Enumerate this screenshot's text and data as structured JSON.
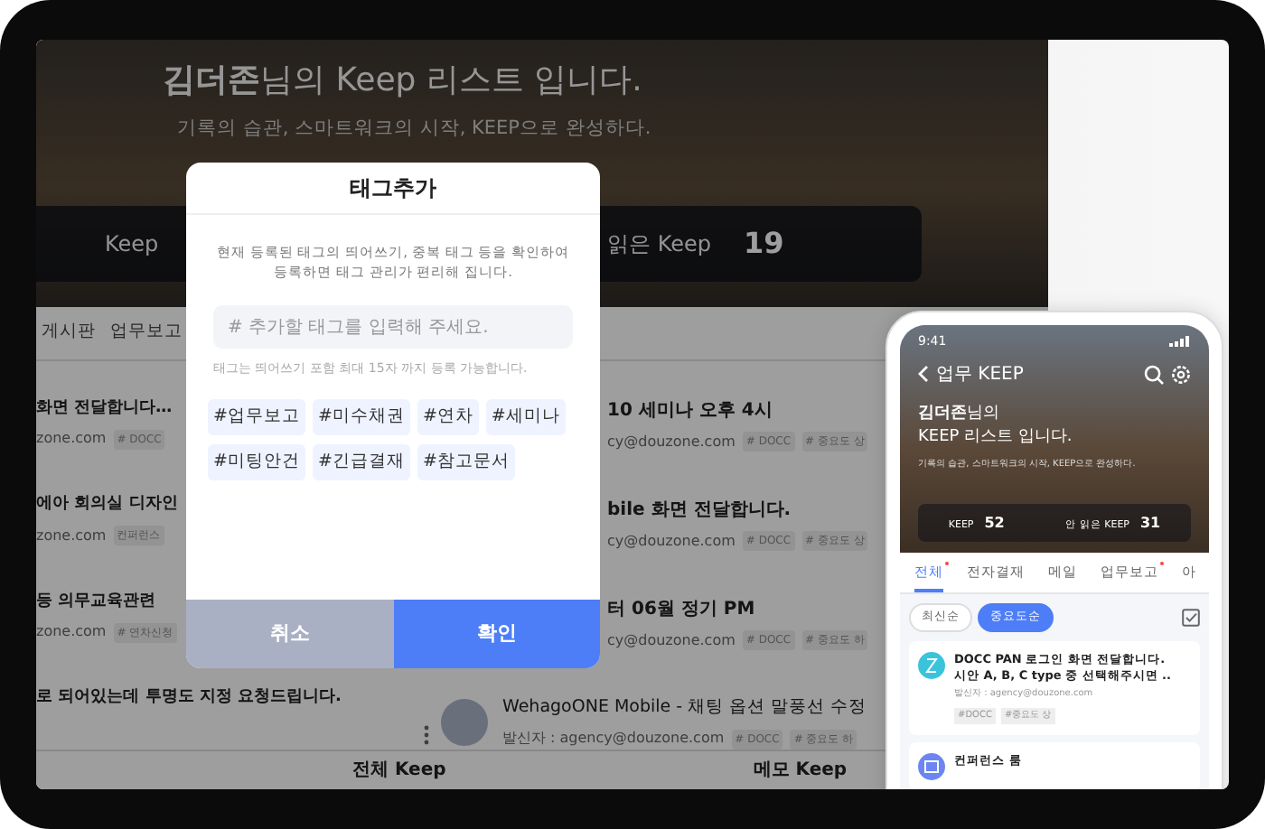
{
  "desktop": {
    "title": "**김더존**님의 Keep 리스트 입니다.",
    "subtitle": "기록의 습관, 스마트워크의 시작, KEEP으로 완성하다.",
    "stats": [
      {
        "label": "Keep"
      },
      {
        "label": "읽은 Keep",
        "value": "19"
      }
    ],
    "tabs": [
      "게시판",
      "업무보고"
    ],
    "left_items": [
      {
        "title": "화면 전달합니다…",
        "sender": "zone.com",
        "tags": [
          "# DOCC"
        ]
      },
      {
        "title": "에아 회의실 디자인",
        "sender": "zone.com",
        "tags": [
          "컨퍼런스"
        ]
      },
      {
        "title": "등 의무교육관련",
        "sender": "zone.com",
        "tags": [
          "# 연차신청"
        ]
      },
      {
        "title": "로 되어있는데 투명도 지정 요청드립니다."
      }
    ],
    "right_items": [
      {
        "kind": "partial",
        "title": "10 세미나 오후 4시",
        "sender": "cy@douzone.com",
        "tags": [
          "# DOCC",
          "# 중요도 상"
        ]
      },
      {
        "kind": "partial",
        "title": "bile 화면 전달합니다.",
        "sender": "cy@douzone.com",
        "tags": [
          "# DOCC",
          "# 중요도 상"
        ]
      },
      {
        "kind": "partial",
        "title": "터 06월 정기 PM",
        "sender": "cy@douzone.com",
        "tags": [
          "# DOCC",
          "# 중요도 하"
        ]
      },
      {
        "kind": "full",
        "title": "WehagoONE Mobile - 채팅 옵션 말풍선 수정",
        "sender": "발신자 : agency@douzone.com",
        "tags": [
          "# DOCC",
          "# 중요도 하"
        ]
      }
    ],
    "bottom_links": [
      "전체 Keep",
      "메모 Keep"
    ]
  },
  "modal": {
    "title": "태그추가",
    "description": "현재 등록된 태그의 띄어쓰기, 중복 태그 등을 확인하여\n등록하면 태그 관리가 편리해 집니다.",
    "placeholder": "# 추가할 태그를 입력해 주세요.",
    "hint": "태그는 띄어쓰기 포함 최대 15자 까지 등록 가능합니다.",
    "tags": [
      "#업무보고",
      "#미수채권",
      "#연차",
      "#세미나",
      "#미팅안건",
      "#긴급결재",
      "#참고문서"
    ],
    "buttons": [
      {
        "label": "취소",
        "kind": "cancel"
      },
      {
        "label": "확인",
        "kind": "confirm"
      }
    ]
  },
  "phone": {
    "time": "9:41",
    "nav_title": "업무 KEEP",
    "title": "**김더존**님의\nKEEP 리스트 입니다.",
    "subtitle": "기록의 습관, 스마트워크의 시작, KEEP으로 완성하다.",
    "stats": [
      {
        "label": "KEEP",
        "value": "52"
      },
      {
        "label": "안 읽은 KEEP",
        "value": "31"
      }
    ],
    "tabs": [
      {
        "label": "전체",
        "selected": true,
        "new": true
      },
      {
        "label": "전자결재",
        "selected": false,
        "new": false
      },
      {
        "label": "메일",
        "selected": false,
        "new": false
      },
      {
        "label": "업무보고",
        "selected": false,
        "new": true
      },
      {
        "label": "아",
        "selected": false,
        "new": false
      }
    ],
    "sort": [
      {
        "label": "최신순",
        "selected": false
      },
      {
        "label": "중요도순",
        "selected": true
      }
    ],
    "cards": [
      {
        "kind": "logo",
        "title": "DOCC PAN 로그인 화면 전달합니다.\n시안 A, B, C type 중 선택해주시면 ..",
        "sender": "발신자 : agency@douzone.com",
        "tags": [
          "#DOCC",
          "#중요도 상"
        ]
      },
      {
        "kind": "calendar",
        "title": "컨퍼런스 룸"
      }
    ]
  }
}
